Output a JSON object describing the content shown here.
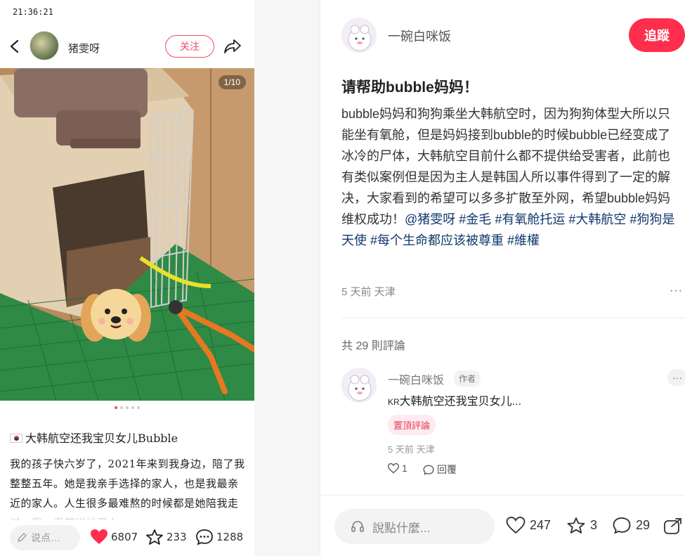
{
  "status_bar": {
    "time": "21:36:21"
  },
  "phone_header": {
    "author_name": "猪雯呀",
    "follow_label": "关注"
  },
  "photo": {
    "counter": "1/10",
    "total_dots": 5,
    "active_dot": 0
  },
  "note": {
    "title": "大韩航空还我宝贝女儿Bubble",
    "body": "我的孩子快六岁了，2021年来到我身边，陪了我整整五年。她是我亲手选择的家人，也是我最亲近的家人。人生很多最难熬的时候都是她陪我走过，我一直都说她是上"
  },
  "phone_bottom": {
    "comment_placeholder": "说点…",
    "likes": "6807",
    "stars": "233",
    "comments": "1288"
  },
  "detail": {
    "author_name": "一碗白咪饭",
    "follow_label": "追蹤",
    "title": "请帮助bubble妈妈！",
    "body_text": "bubble妈妈和狗狗乘坐大韩航空时，因为狗狗体型大所以只能坐有氧舱，但是妈妈接到bubble的时候bubble已经变成了冰冷的尸体，大韩航空目前什么都不提供给受害者，此前也有类似案例但是因为主人是韩国人所以事件得到了一定的解决，大家看到的希望可以多多扩散至外网，希望bubble妈妈维权成功！",
    "tags": [
      "@猪雯呀",
      "#金毛",
      "#有氧舱托运",
      "#大韩航空",
      "#狗狗是天使",
      "#每个生命都应该被尊重",
      "#維權"
    ],
    "meta": "5 天前 天津",
    "more": "···",
    "comment_count": "共 29 則評論"
  },
  "comment": {
    "author": "一碗白咪饭",
    "badge": "作者",
    "more": "···",
    "prefix": "KR",
    "text": "大韩航空还我宝贝女儿...",
    "pinned_label": "置頂評論",
    "meta": "5 天前 天津",
    "likes": "1",
    "reply_label": "回覆"
  },
  "detail_bottom": {
    "placeholder": "說點什麼...",
    "likes": "247",
    "stars": "3",
    "comments": "29"
  },
  "colors": {
    "brand_red": "#ff2e4d",
    "tag_blue": "#13386c"
  }
}
